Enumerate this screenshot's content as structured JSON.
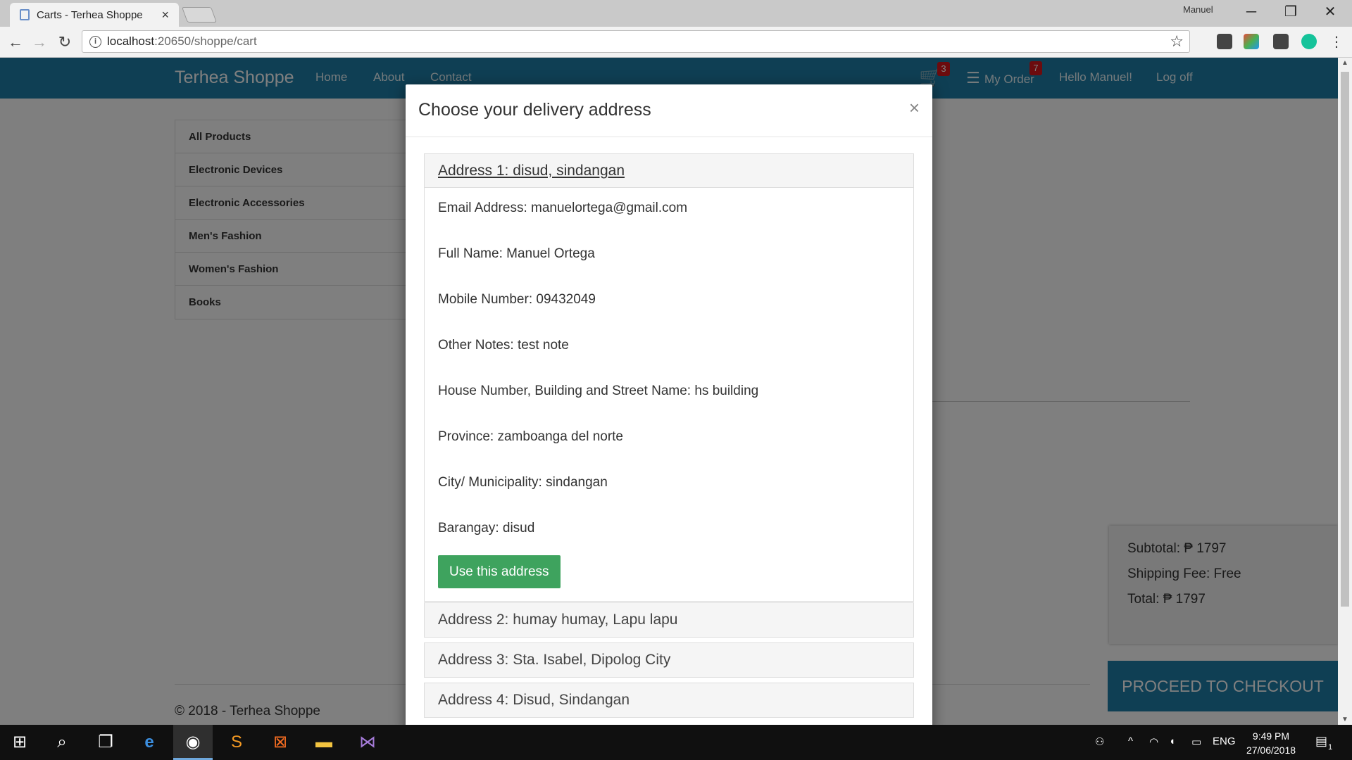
{
  "browser": {
    "tab_title": "Carts - Terhea Shoppe",
    "tab_close": "×",
    "profile_name": "Manuel",
    "url_host": "localhost",
    "url_path": ":20650/shoppe/cart"
  },
  "navbar": {
    "brand": "Terhea Shoppe",
    "links": [
      "Home",
      "About",
      "Contact"
    ],
    "cart_badge": "3",
    "my_order_label": "My Order",
    "order_badge": "7",
    "greeting": "Hello Manuel!",
    "logoff": "Log off"
  },
  "sidebar": {
    "categories": [
      "All Products",
      "Electronic Devices",
      "Electronic Accessories",
      "Men's Fashion",
      "Women's Fashion",
      "Books"
    ]
  },
  "summary": {
    "subtotal": "Subtotal: ₱ 1797",
    "shipping": "Shipping Fee: Free",
    "total": "Total: ₱ 1797"
  },
  "checkout_label": "PROCEED TO CHECKOUT",
  "footer": "© 2018 - Terhea Shoppe",
  "modal": {
    "title": "Choose your delivery address",
    "close": "×",
    "address1": {
      "heading": "Address 1: disud, sindangan",
      "email": "Email Address: manuelortega@gmail.com",
      "full_name": "Full Name: Manuel Ortega",
      "mobile": "Mobile Number: 09432049",
      "notes": "Other Notes: test note",
      "house": "House Number, Building and Street Name: hs building",
      "province": "Province: zamboanga del norte",
      "city": "City/ Municipality: sindangan",
      "barangay": "Barangay: disud",
      "use_button": "Use this address"
    },
    "address2": "Address 2: humay humay, Lapu lapu",
    "address3": "Address 3: Sta. Isabel, Dipolog City",
    "address4": "Address 4: Disud, Sindangan"
  },
  "taskbar": {
    "lang": "ENG",
    "time": "9:49 PM",
    "date": "27/06/2018",
    "notif_count": "1"
  },
  "colors": {
    "navbar": "#1f7fa8",
    "badge": "#d9161c",
    "use_button": "#3ea35e"
  }
}
